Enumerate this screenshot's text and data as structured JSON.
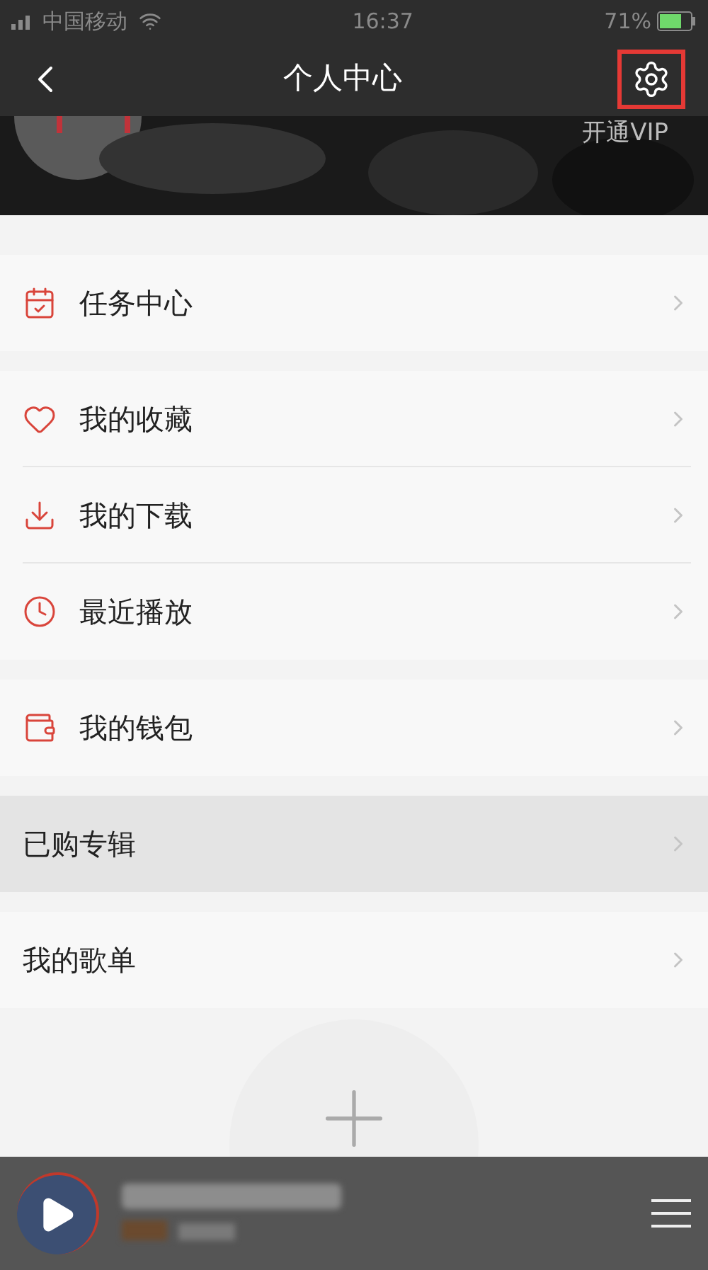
{
  "status_bar": {
    "carrier": "中国移动",
    "time": "16:37",
    "battery": "71%"
  },
  "header": {
    "title": "个人中心",
    "settings_highlighted": true
  },
  "banner": {
    "vip_link": "开通VIP"
  },
  "groups": [
    {
      "items": [
        {
          "label": "任务中心",
          "kind": "icon",
          "pressed": false
        }
      ]
    },
    {
      "items": [
        {
          "label": "我的收藏",
          "kind": "icon",
          "pressed": false
        },
        {
          "label": "我的下载",
          "kind": "icon",
          "pressed": false
        },
        {
          "label": "最近播放",
          "kind": "icon",
          "pressed": false
        }
      ]
    },
    {
      "items": [
        {
          "label": "我的钱包",
          "kind": "icon",
          "pressed": false
        }
      ]
    },
    {
      "items": [
        {
          "label": "已购专辑",
          "kind": "plain",
          "pressed": true
        }
      ]
    },
    {
      "items": [
        {
          "label": "我的歌单",
          "kind": "plain",
          "pressed": false
        }
      ]
    }
  ],
  "player": {
    "playing": false
  }
}
